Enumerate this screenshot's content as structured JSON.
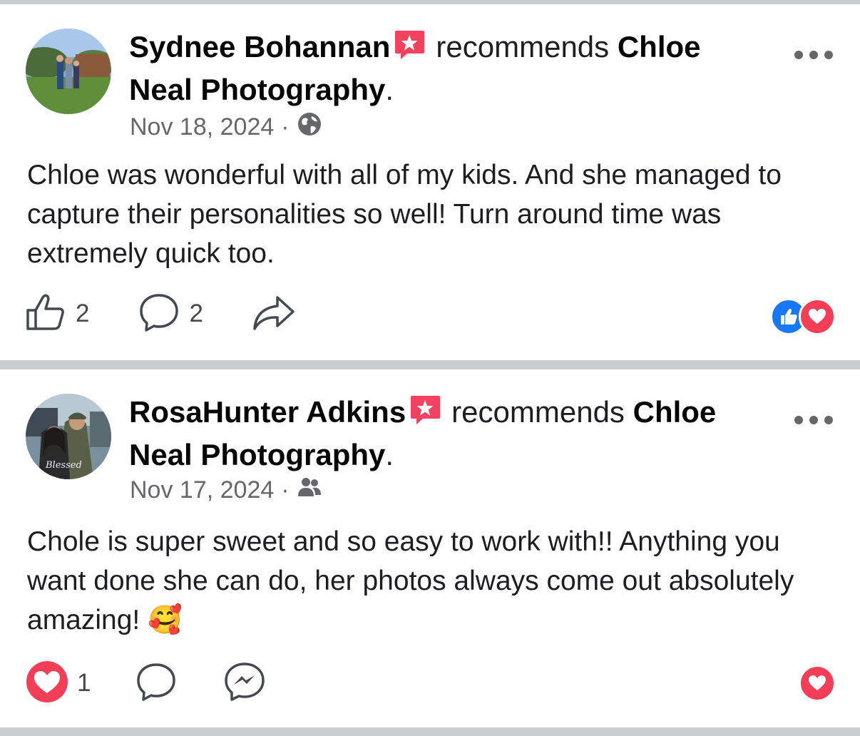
{
  "posts": [
    {
      "author": "Sydnee Bohannan",
      "verb": "recommends",
      "page": "Chloe Neal Photography",
      "punct": ".",
      "date": "Nov 18, 2024",
      "separator": "·",
      "audience_icon": "globe-icon",
      "text": "Chloe was wonderful with all of my kids. And she managed to capture their personalities so well! Turn around time was extremely quick too.",
      "actions": {
        "like_count": "2",
        "comment_count": "2"
      },
      "reactions": [
        "like-reaction-icon",
        "love-reaction-icon"
      ]
    },
    {
      "author": "RosaHunter Adkins",
      "verb": "recommends",
      "page": "Chloe Neal Photography",
      "punct": ".",
      "date": "Nov 17, 2024",
      "separator": "·",
      "audience_icon": "friends-icon",
      "text": "Chole is super sweet and so easy to work with!! Anything you want done she can do, her photos always come out absolutely amazing! 🥰",
      "avatar_caption": "Blessed",
      "actions": {
        "love_count": "1"
      },
      "reactions": [
        "love-reaction-icon"
      ]
    }
  ],
  "colors": {
    "text": "#1c1e21",
    "meta": "#65676b",
    "separator": "#c9ccd1",
    "badge": "#f3425f",
    "like_blue": "#1877f2",
    "love_red": "#f33e58"
  }
}
